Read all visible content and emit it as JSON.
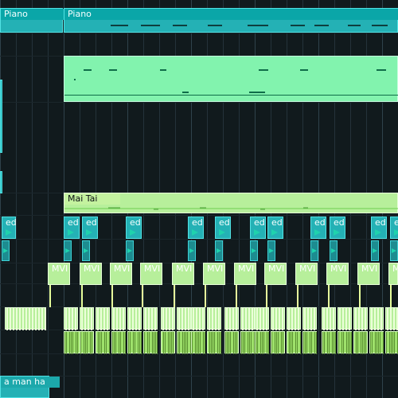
{
  "colors": {
    "background": "#111a1d",
    "track_piano": "#24b1b5",
    "track_mint": "#6fe8a7",
    "track_lime": "#b7ef9b",
    "track_green": "#9ee16b",
    "grid": "#2f424b"
  },
  "tracks": {
    "piano_left_label": "Piano",
    "piano_right_label": "Piano",
    "mai_tai_label": "Mai Tai",
    "ed_label": "ed",
    "mvi_label": "MVI",
    "bottom_label": "a man ha"
  },
  "icons": {
    "play": "play-icon",
    "arrow": "arrow-icon"
  }
}
